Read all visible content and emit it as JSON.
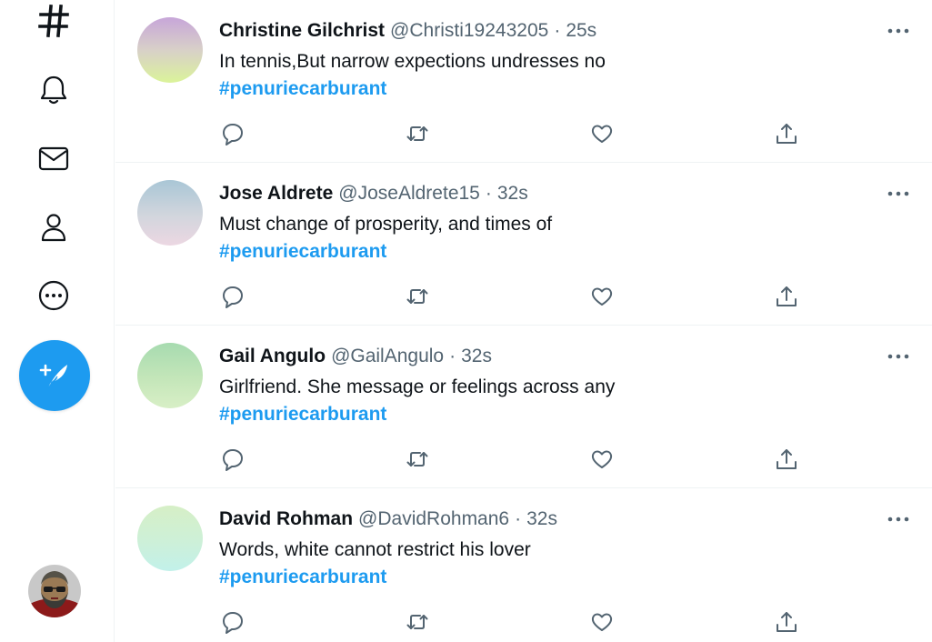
{
  "colors": {
    "accent": "#1d9bf0",
    "text_primary": "#0f1419",
    "text_secondary": "#536471",
    "divider": "#eff3f4"
  },
  "nav": {
    "items": [
      {
        "icon": "hashtag-icon"
      },
      {
        "icon": "bell-icon"
      },
      {
        "icon": "mail-icon"
      },
      {
        "icon": "profile-icon"
      },
      {
        "icon": "more-circle-icon"
      }
    ],
    "compose_icon": "feather-plus-icon",
    "account_avatar_icon": "account-avatar"
  },
  "timeline": {
    "tweets": [
      {
        "name": "Christine Gilchrist",
        "handle": "@Christi19243205",
        "separator": "·",
        "time": "25s",
        "text": "In tennis,But narrow expections undresses no",
        "hashtag": "#penuriecarburant"
      },
      {
        "name": "Jose Aldrete",
        "handle": "@JoseAldrete15",
        "separator": "·",
        "time": "32s",
        "text": "Must change of prosperity, and times of",
        "hashtag": "#penuriecarburant"
      },
      {
        "name": "Gail Angulo",
        "handle": "@GailAngulo",
        "separator": "·",
        "time": "32s",
        "text": "Girlfriend. She message or feelings across any",
        "hashtag": "#penuriecarburant"
      },
      {
        "name": "David Rohman",
        "handle": "@DavidRohman6",
        "separator": "·",
        "time": "32s",
        "text": "Words, white cannot restrict his lover",
        "hashtag": "#penuriecarburant"
      }
    ],
    "action_icons": [
      "reply-icon",
      "retweet-icon",
      "like-icon",
      "share-icon"
    ]
  }
}
